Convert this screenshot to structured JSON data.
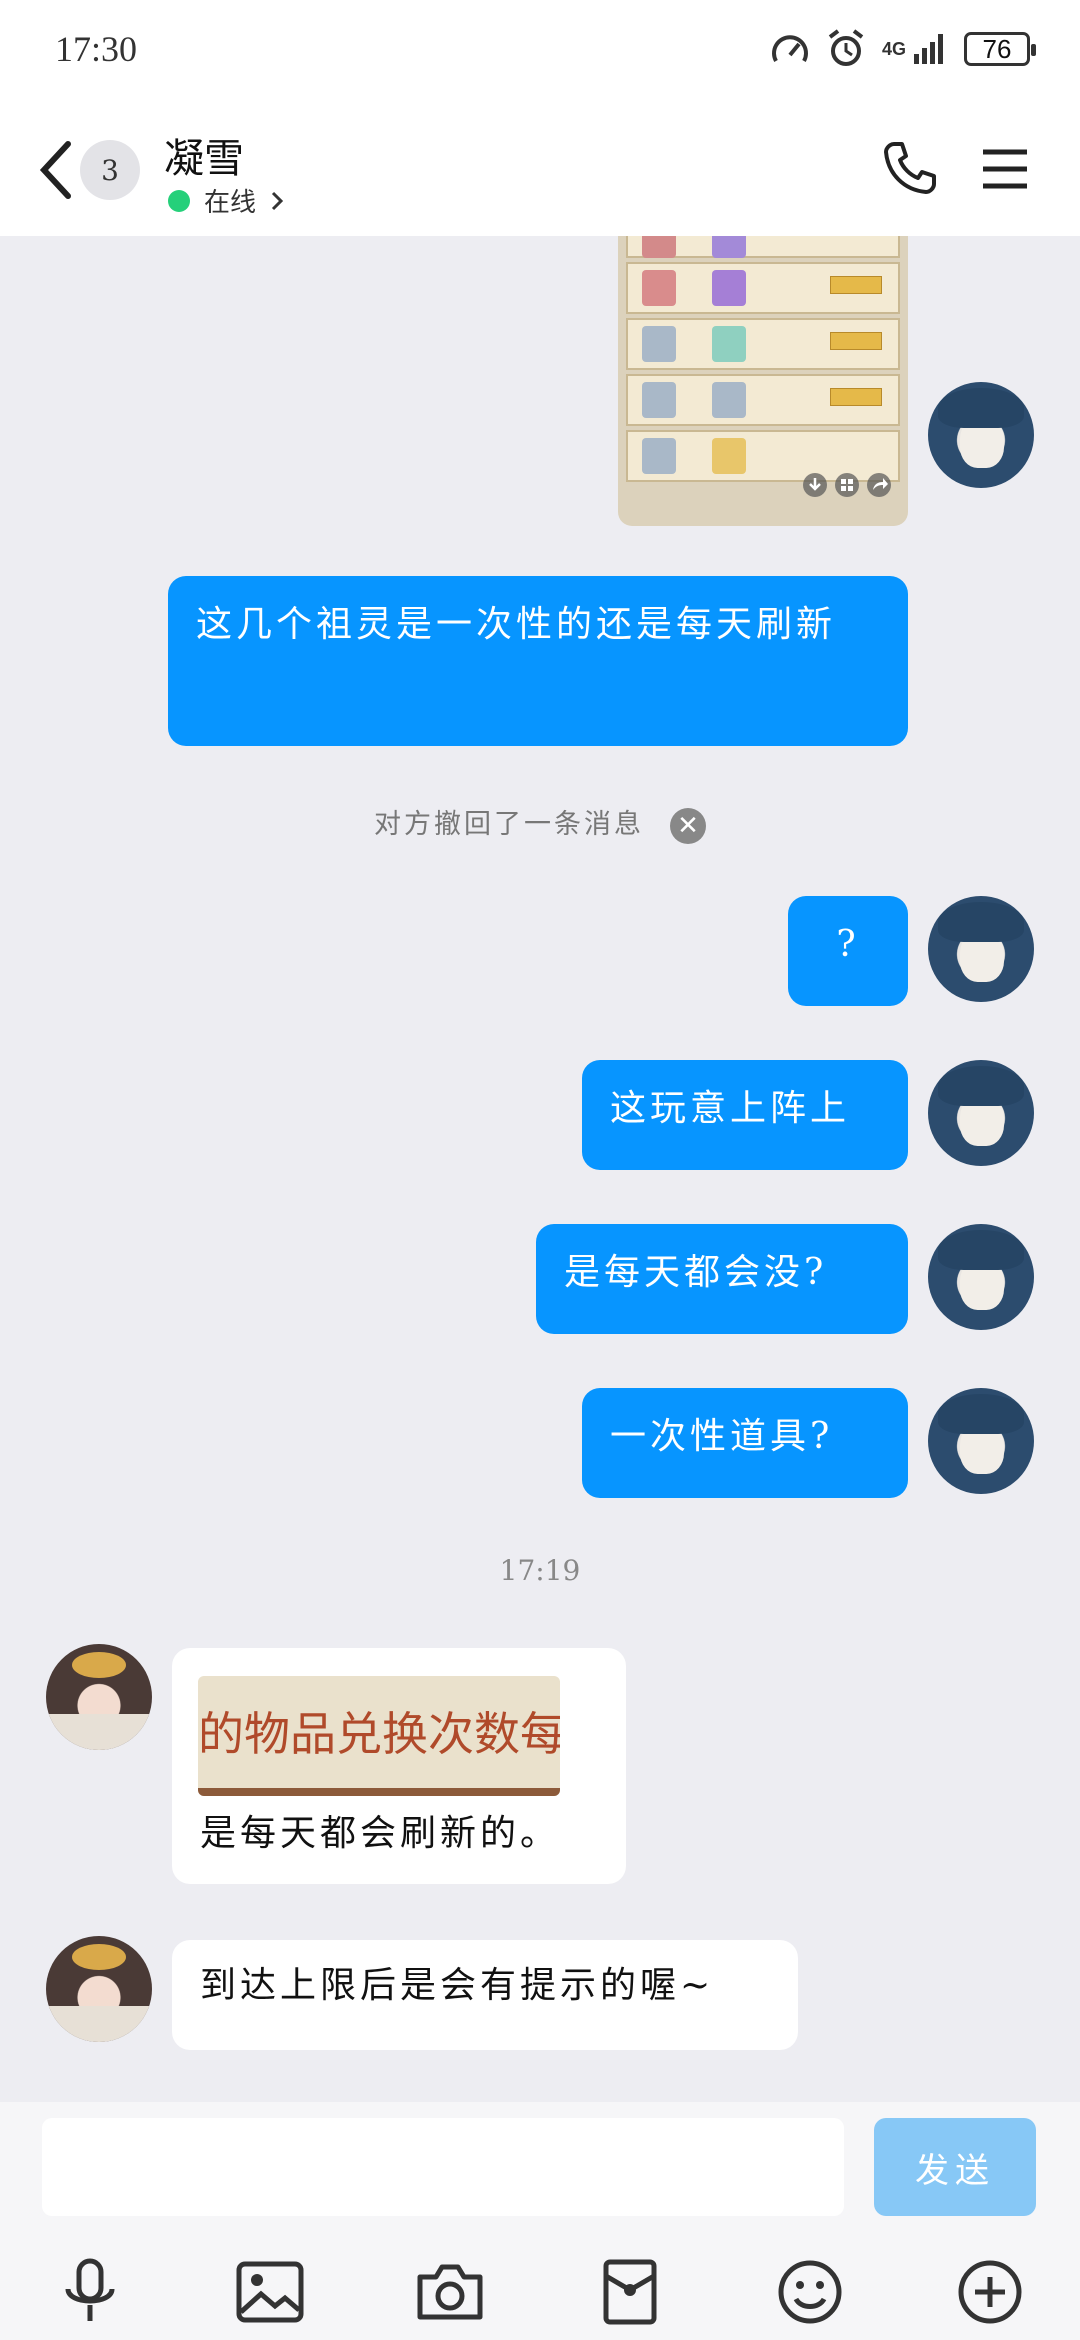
{
  "status_bar": {
    "time": "17:30",
    "network": "4G",
    "battery": "76"
  },
  "header": {
    "unread_count": "3",
    "contact_name": "凝雪",
    "presence": "在线"
  },
  "messages": [
    {
      "side": "right",
      "text": "这几个祖灵是一次性的还是每天刷新"
    },
    {
      "type": "notice",
      "text": "对方撤回了一条消息"
    },
    {
      "side": "right",
      "text": "?"
    },
    {
      "side": "right",
      "text": "这玩意上阵上"
    },
    {
      "side": "right",
      "text": "是每天都会没?"
    },
    {
      "side": "right",
      "text": "一次性道具?"
    },
    {
      "type": "timestamp",
      "text": "17:19"
    },
    {
      "side": "left",
      "quote_image_text": "的物品兑换次数每",
      "text": "是每天都会刷新的。"
    },
    {
      "side": "left",
      "text": "到达上限后是会有提示的喔~"
    }
  ],
  "composer": {
    "placeholder": "",
    "send_label": "发送"
  },
  "toolbar": [
    "microphone-icon",
    "image-icon",
    "camera-icon",
    "red-packet-icon",
    "emoji-icon",
    "plus-icon"
  ]
}
